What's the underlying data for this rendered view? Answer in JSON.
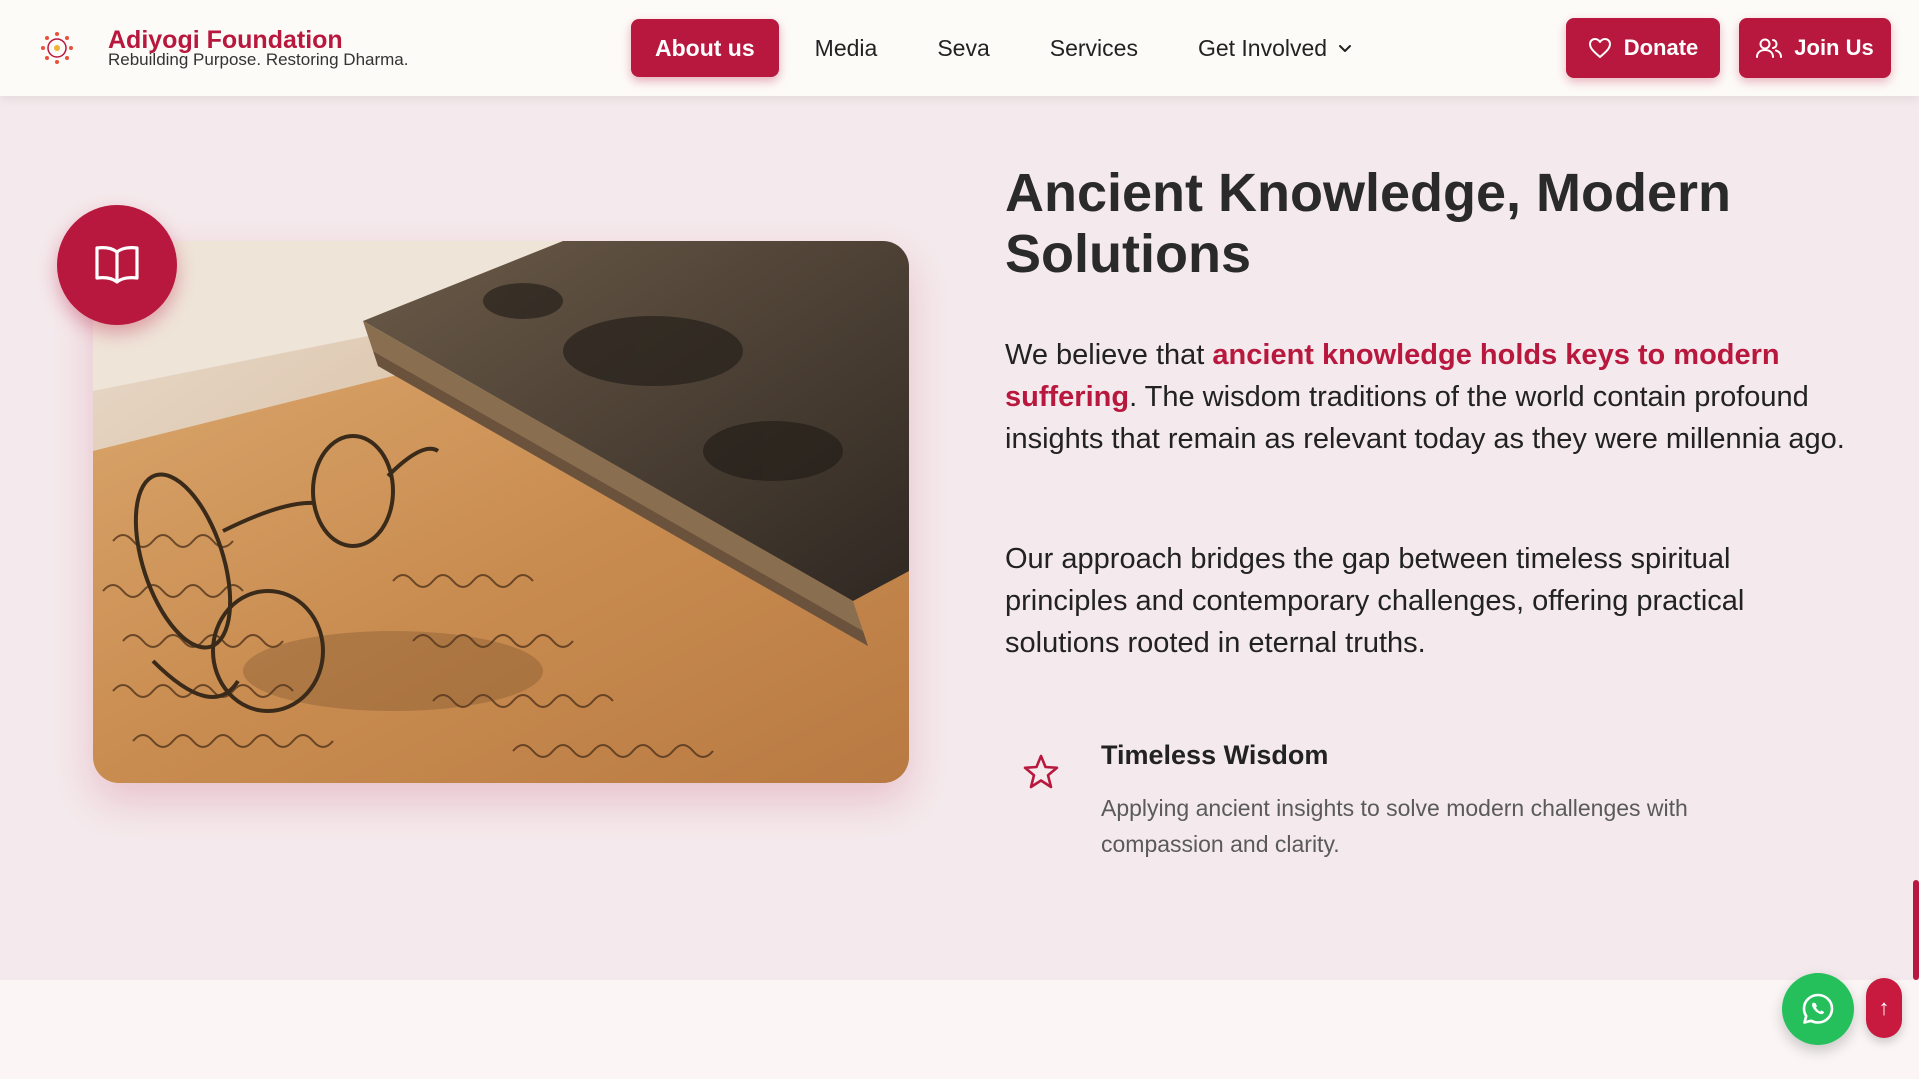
{
  "header": {
    "brand_name": "Adiyogi Foundation",
    "brand_tagline": "Rebuilding Purpose. Restoring Dharma.",
    "nav": [
      {
        "label": "About us",
        "active": true
      },
      {
        "label": "Media",
        "active": false
      },
      {
        "label": "Seva",
        "active": false
      },
      {
        "label": "Services",
        "active": false
      },
      {
        "label": "Get Involved",
        "active": false,
        "has_dropdown": true
      }
    ],
    "donate_label": "Donate",
    "join_label": "Join Us"
  },
  "main": {
    "heading": "Ancient Knowledge, Modern Solutions",
    "para1_prefix": "We believe that ",
    "para1_highlight": "ancient knowledge holds keys to modern suffering",
    "para1_suffix": ". The wisdom traditions of the world contain profound insights that remain as relevant today as they were millennia ago.",
    "para2": "Our approach bridges the gap between timeless spiritual principles and contemporary challenges, offering practical solutions rooted in eternal truths.",
    "feature": {
      "icon": "star-icon",
      "title": "Timeless Wisdom",
      "description": "Applying ancient insights to solve modern challenges with compassion and clarity."
    },
    "image_icon": "book-open-icon"
  },
  "floating": {
    "whatsapp_icon": "whatsapp-icon",
    "scroll_top_symbol": "↑"
  },
  "colors": {
    "accent": "#b8183e",
    "section_bg": "#f4e9ec",
    "whatsapp": "#25c05b"
  }
}
